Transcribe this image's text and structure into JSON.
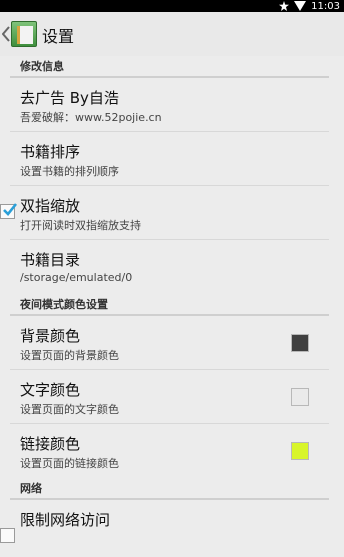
{
  "status_bar": {
    "time": "11:03"
  },
  "action_bar": {
    "title": "设置",
    "icon": "book-app-icon"
  },
  "sections": [
    {
      "header": "修改信息",
      "items": [
        {
          "title": "去广告 By自浩",
          "summary": "吾爱破解：www.52pojie.cn"
        },
        {
          "title": "书籍排序",
          "summary": "设置书籍的排列顺序"
        },
        {
          "title": "双指缩放",
          "summary": "打开阅读时双指缩放支持",
          "checked": true
        },
        {
          "title": "书籍目录",
          "summary": "/storage/emulated/0"
        }
      ]
    },
    {
      "header": "夜间模式颜色设置",
      "items": [
        {
          "title": "背景颜色",
          "summary": "设置页面的背景颜色",
          "color": "#3f3f3f"
        },
        {
          "title": "文字颜色",
          "summary": "设置页面的文字颜色",
          "color": "#eaeaea"
        },
        {
          "title": "链接颜色",
          "summary": "设置页面的链接颜色",
          "color": "#d8f52a"
        }
      ]
    },
    {
      "header": "网络",
      "items": [
        {
          "title": "限制网络访问",
          "summary": "",
          "checked": false
        }
      ]
    }
  ]
}
